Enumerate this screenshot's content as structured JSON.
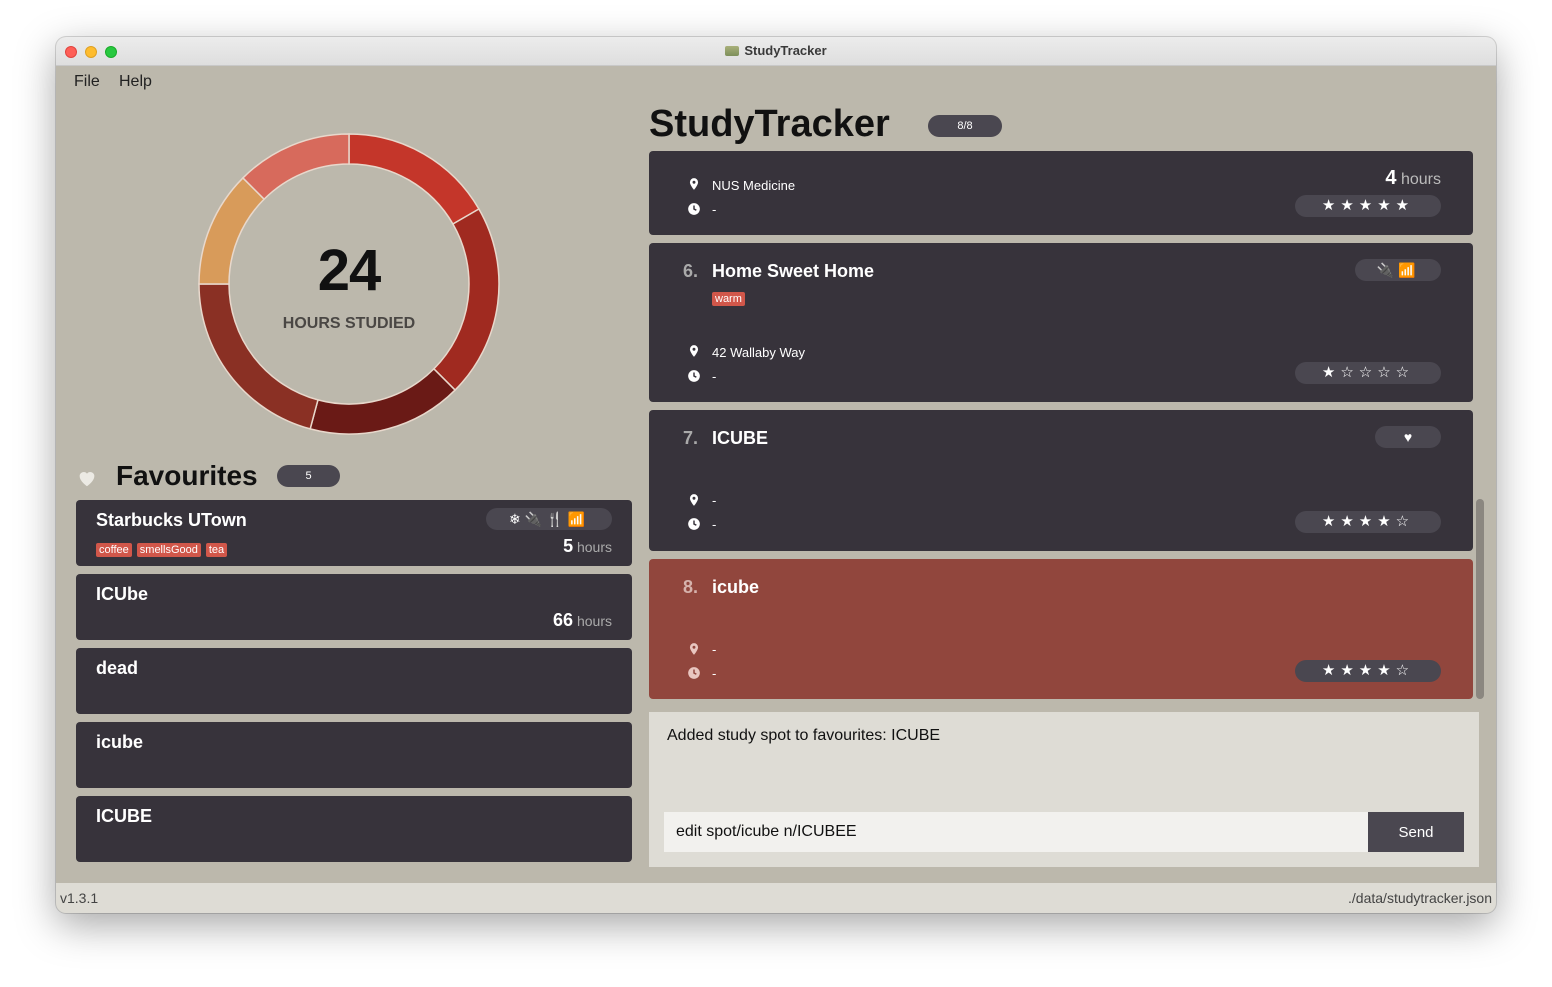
{
  "window": {
    "title": "StudyTracker"
  },
  "menu": [
    "File",
    "Help"
  ],
  "stats": {
    "hours": "24",
    "label": "HOURS STUDIED",
    "segments": [
      {
        "value": 4,
        "color": "#c4362a"
      },
      {
        "value": 5,
        "color": "#a02a20"
      },
      {
        "value": 4,
        "color": "#6a1a16"
      },
      {
        "value": 5,
        "color": "#8a3024"
      },
      {
        "value": 3,
        "color": "#d89b5a"
      },
      {
        "value": 3,
        "color": "#d76a5c"
      }
    ]
  },
  "favourites": {
    "title": "Favourites",
    "count": "5",
    "items": [
      {
        "name": "Starbucks UTown",
        "amenities": "❄🔌🍴📶",
        "tags": [
          "coffee",
          "smellsGood",
          "tea"
        ],
        "hours": "5",
        "hours_unit": "hours"
      },
      {
        "name": "ICUbe",
        "hours": "66",
        "hours_unit": "hours"
      },
      {
        "name": "dead"
      },
      {
        "name": "icube"
      },
      {
        "name": "ICUBE"
      }
    ]
  },
  "main": {
    "title": "StudyTracker",
    "count": "8/8",
    "spots": [
      {
        "index": "",
        "name": "",
        "address": "NUS Medicine",
        "time": "-",
        "hours": "4",
        "hours_unit": "hours",
        "rating": 5
      },
      {
        "index": "6.",
        "name": "Home Sweet Home",
        "tags": [
          "warm"
        ],
        "amenities": "🔌📶",
        "address": "42 Wallaby Way",
        "time": "-",
        "rating": 1
      },
      {
        "index": "7.",
        "name": "ICUBE",
        "amenities": "♥",
        "address": "-",
        "time": "-",
        "rating": 4
      },
      {
        "index": "8.",
        "name": "icube",
        "address": "-",
        "time": "-",
        "rating": 4
      }
    ]
  },
  "result": {
    "text": "Added study spot to favourites: ICUBE"
  },
  "command": {
    "value": "edit spot/icube n/ICUBEE",
    "send_label": "Send"
  },
  "status": {
    "version": "v1.3.1",
    "path": "./data/studytracker.json"
  },
  "colors": {
    "background": "#bcb8ac",
    "card": "#37333b",
    "selected": "#91463d",
    "tag": "#d1574a"
  }
}
